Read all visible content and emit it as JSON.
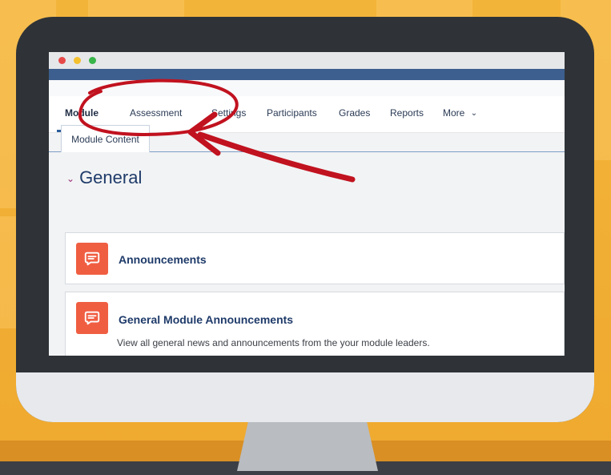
{
  "nav": {
    "items": [
      {
        "label": "Module",
        "active": true
      },
      {
        "label": "Assessment",
        "active": false
      },
      {
        "label": "Settings",
        "active": false
      },
      {
        "label": "Participants",
        "active": false
      },
      {
        "label": "Grades",
        "active": false
      },
      {
        "label": "Reports",
        "active": false
      },
      {
        "label": "More",
        "active": false
      }
    ]
  },
  "tab": {
    "label": "Module Content"
  },
  "section": {
    "title": "General"
  },
  "cards": [
    {
      "title": "Announcements",
      "icon": "forum-icon"
    },
    {
      "title": "General Module Announcements",
      "description": "View all general news and announcements from the your module leaders.",
      "icon": "forum-icon"
    }
  ],
  "colors": {
    "accent_blue": "#3d5f8f",
    "underline_blue": "#2b5d9b",
    "card_icon_bg": "#f05e42",
    "annotation_red": "#c1121f",
    "background_orange": "#f1ac32"
  },
  "window_controls": [
    "close-dot",
    "minimize-dot",
    "zoom-dot"
  ]
}
